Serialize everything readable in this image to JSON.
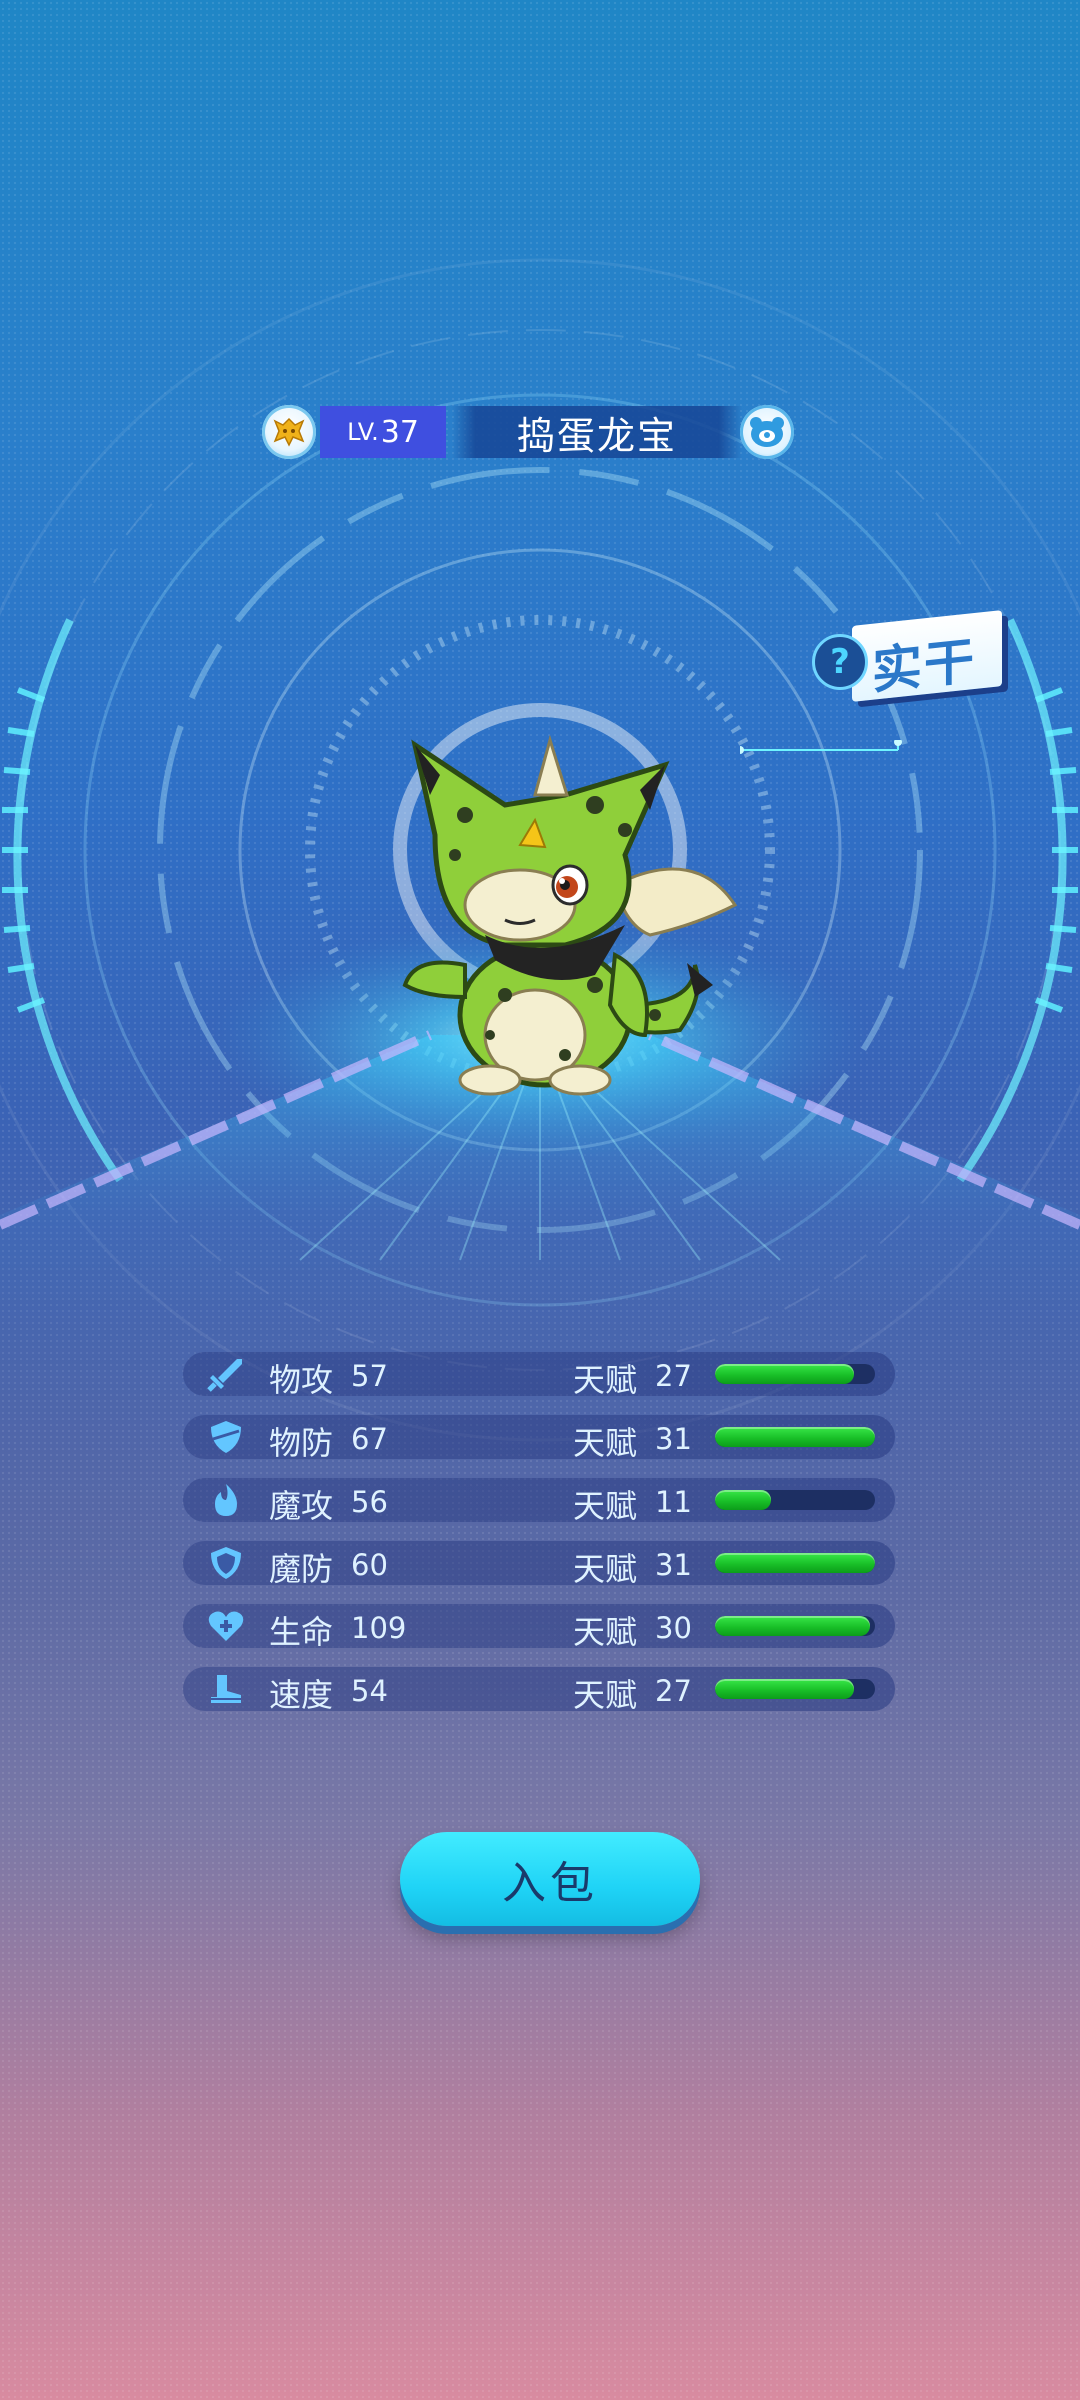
{
  "pet": {
    "level_label": "LV.",
    "level": "37",
    "name": "捣蛋龙宝",
    "trait": "实干",
    "trait_help": "?"
  },
  "stats": [
    {
      "icon": "sword-icon",
      "name": "物攻",
      "value": "57",
      "talent_label": "天赋",
      "talent": "27",
      "talent_ratio": 0.87
    },
    {
      "icon": "shield-icon",
      "name": "物防",
      "value": "67",
      "talent_label": "天赋",
      "talent": "31",
      "talent_ratio": 1.0
    },
    {
      "icon": "flame-icon",
      "name": "魔攻",
      "value": "56",
      "talent_label": "天赋",
      "talent": "11",
      "talent_ratio": 0.35
    },
    {
      "icon": "magic-shield-icon",
      "name": "魔防",
      "value": "60",
      "talent_label": "天赋",
      "talent": "31",
      "talent_ratio": 1.0
    },
    {
      "icon": "heart-plus-icon",
      "name": "生命",
      "value": "109",
      "talent_label": "天赋",
      "talent": "30",
      "talent_ratio": 0.97
    },
    {
      "icon": "boot-icon",
      "name": "速度",
      "value": "54",
      "talent_label": "天赋",
      "talent": "27",
      "talent_ratio": 0.87
    }
  ],
  "actions": {
    "add_to_bag": "入包"
  },
  "colors": {
    "bar_fill": "#19c028",
    "bar_track": "#1d2f63",
    "button": "#1fd3f6",
    "level_box": "#3f4fe0"
  }
}
